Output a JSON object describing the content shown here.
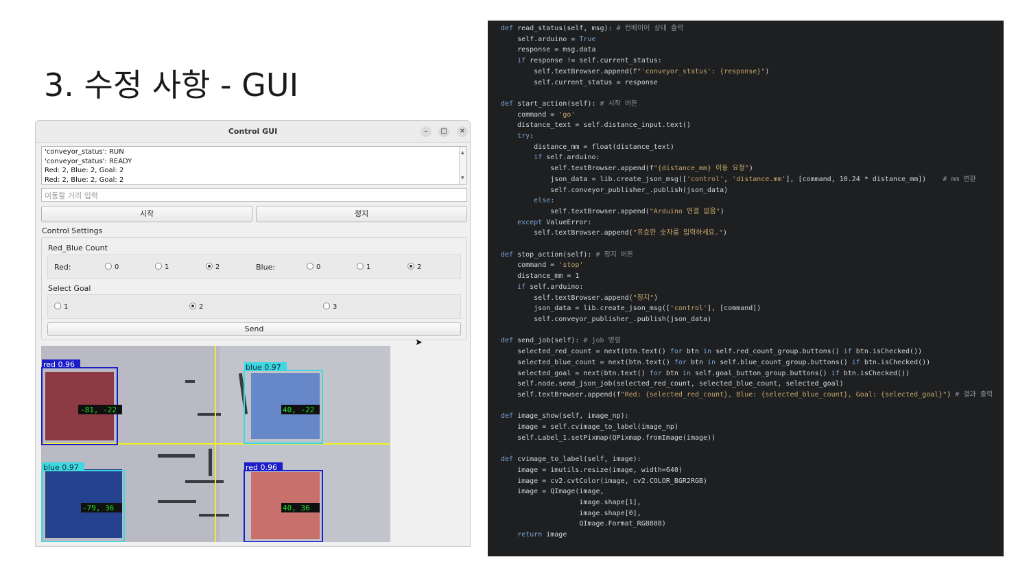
{
  "slide": {
    "title": "3. 수정 사항 - GUI"
  },
  "window": {
    "title": "Control GUI",
    "minimize": "–",
    "maximize": "□",
    "close": "✕"
  },
  "log": {
    "lines": [
      "'conveyor_status': RUN",
      "'conveyor_status': READY",
      "Red: 2, Blue: 2, Goal: 2",
      "Red: 2, Blue: 2, Goal: 2"
    ],
    "scroll_up": "▲",
    "scroll_down": "▼"
  },
  "distance_input": {
    "placeholder": "이동할 거리 입력",
    "value": ""
  },
  "buttons": {
    "start": "시작",
    "stop": "정지",
    "send": "Send"
  },
  "control_settings": {
    "label": "Control Settings",
    "red_blue_group": "Red_Blue Count",
    "red_label": "Red:",
    "blue_label": "Blue:",
    "red_options": [
      "0",
      "1",
      "2"
    ],
    "red_selected": "2",
    "blue_options": [
      "0",
      "1",
      "2"
    ],
    "blue_selected": "2",
    "goal_group": "Select Goal",
    "goal_options": [
      "1",
      "2",
      "3"
    ],
    "goal_selected": "2"
  },
  "camera": {
    "detections": [
      {
        "label": "red 0.96",
        "coord": "-81, -22"
      },
      {
        "label": "blue 0.97",
        "coord": "40, -22"
      },
      {
        "label": "blue 0.97",
        "coord": "-79, 36"
      },
      {
        "label": "red 0.96",
        "coord": "40, 36"
      }
    ]
  },
  "code": {
    "lines": [
      "def read_status(self, msg): # 컨베이어 상태 출력",
      "    self.arduino = True",
      "    response = msg.data",
      "    if response != self.current_status:",
      "        self.textBrowser.append(f\"'conveyor_status': {response}\")",
      "        self.current_status = response",
      "",
      "def start_action(self): # 시작 버튼",
      "    command = 'go'",
      "    distance_text = self.distance_input.text()",
      "    try:",
      "        distance_mm = float(distance_text)",
      "        if self.arduino:",
      "            self.textBrowser.append(f\"{distance_mm} 이동 요청\")",
      "            json_data = lib.create_json_msg(['control', 'distance.mm'], [command, 10.24 * distance_mm])    # mm 변환",
      "            self.conveyor_publisher_.publish(json_data)",
      "        else:",
      "            self.textBrowser.append(\"Arduino 연결 없음\")",
      "    except ValueError:",
      "        self.textBrowser.append(\"유효한 숫자를 입력하세요.\")",
      "",
      "def stop_action(self): # 정지 버튼",
      "    command = 'stop'",
      "    distance_mm = 1",
      "    if self.arduino:",
      "        self.textBrowser.append(\"정지\")",
      "        json_data = lib.create_json_msg(['control'], [command])",
      "        self.conveyor_publisher_.publish(json_data)",
      "",
      "def send_job(self): # job 명령",
      "    selected_red_count = next(btn.text() for btn in self.red_count_group.buttons() if btn.isChecked())",
      "    selected_blue_count = next(btn.text() for btn in self.blue_count_group.buttons() if btn.isChecked())",
      "    selected_goal = next(btn.text() for btn in self.goal_button_group.buttons() if btn.isChecked())",
      "    self.node.send_json_job(selected_red_count, selected_blue_count, selected_goal)",
      "    self.textBrowser.append(f\"Red: {selected_red_count}, Blue: {selected_blue_count}, Goal: {selected_goal}\") # 결과 출력",
      "",
      "def image_show(self, image_np):",
      "    image = self.cvimage_to_label(image_np)",
      "    self.Label_1.setPixmap(QPixmap.fromImage(image))",
      "",
      "def cvimage_to_label(self, image):",
      "    image = imutils.resize(image, width=640)",
      "    image = cv2.cvtColor(image, cv2.COLOR_BGR2RGB)",
      "    image = QImage(image,",
      "                   image.shape[1],",
      "                   image.shape[0],",
      "                   QImage.Format_RGB888)",
      "    return image"
    ]
  },
  "colors": {
    "code_bg": "#1d1f21",
    "code_text": "#d4d6d8",
    "red_box": "#1c1cc8",
    "blue_box": "#3fd8e0",
    "guide_line": "#f0f020",
    "coord_text": "#20e020"
  }
}
